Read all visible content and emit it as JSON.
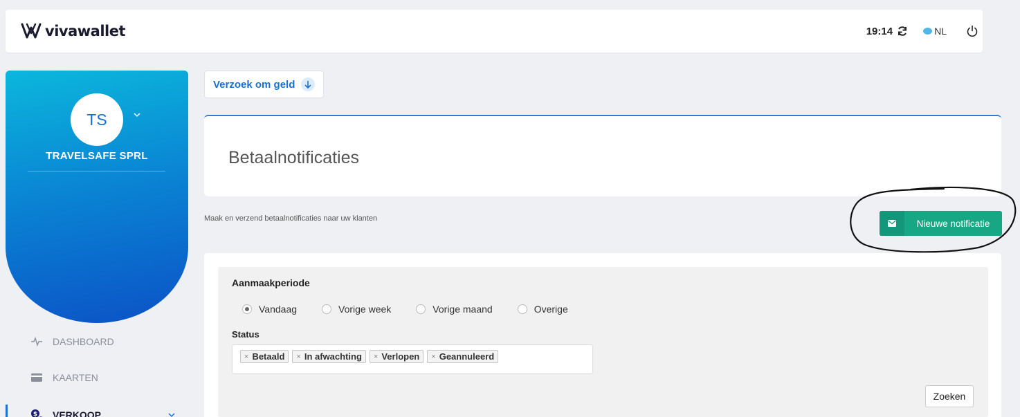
{
  "header": {
    "brand": "vivawallet",
    "time": "19:14",
    "language": "NL"
  },
  "sidebar": {
    "avatar_initials": "TS",
    "company_name": "TRAVELSAFE SPRL",
    "items": [
      {
        "label": "DASHBOARD",
        "icon": "pulse-icon",
        "active": false
      },
      {
        "label": "KAARTEN",
        "icon": "card-icon",
        "active": false
      },
      {
        "label": "VERKOOP",
        "icon": "sales-icon",
        "active": true
      }
    ],
    "accent_color": "#1b6fd0"
  },
  "main": {
    "request_button": "Verzoek om geld",
    "page_title": "Betaalnotificaties",
    "subtitle": "Maak en verzend betaalnotificaties naar uw klanten",
    "new_notification_button": "Nieuwe notificatie",
    "filters": {
      "period_label": "Aanmaakperiode",
      "period_options": [
        {
          "label": "Vandaag",
          "selected": true
        },
        {
          "label": "Vorige week",
          "selected": false
        },
        {
          "label": "Vorige maand",
          "selected": false
        },
        {
          "label": "Overige",
          "selected": false
        }
      ],
      "status_label": "Status",
      "status_tags": [
        "Betaald",
        "In afwachting",
        "Verlopen",
        "Geannuleerd"
      ],
      "search_button": "Zoeken"
    }
  },
  "colors": {
    "primary_blue": "#1a6fd0",
    "green_button": "#17a784"
  }
}
